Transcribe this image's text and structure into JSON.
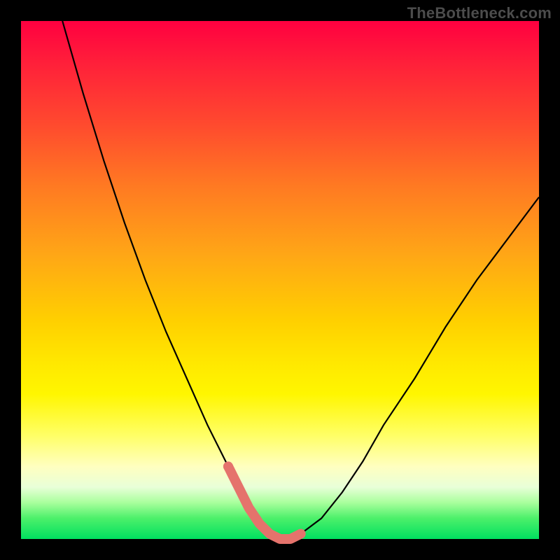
{
  "watermark": "TheBottleneck.com",
  "chart_data": {
    "type": "line",
    "title": "",
    "xlabel": "",
    "ylabel": "",
    "xlim": [
      0,
      100
    ],
    "ylim": [
      0,
      100
    ],
    "series": [
      {
        "name": "bottleneck-curve",
        "x": [
          8,
          12,
          16,
          20,
          24,
          28,
          32,
          36,
          38,
          40,
          42,
          44,
          46,
          48,
          50,
          52,
          54,
          58,
          62,
          66,
          70,
          76,
          82,
          88,
          94,
          100
        ],
        "y": [
          100,
          86,
          73,
          61,
          50,
          40,
          31,
          22,
          18,
          14,
          10,
          6,
          3,
          1,
          0,
          0,
          1,
          4,
          9,
          15,
          22,
          31,
          41,
          50,
          58,
          66
        ]
      },
      {
        "name": "highlight-basin",
        "x": [
          40,
          42,
          44,
          46,
          48,
          50,
          52,
          54
        ],
        "y": [
          14,
          10,
          6,
          3,
          1,
          0,
          0,
          1
        ]
      }
    ],
    "highlight_color": "#e5736c",
    "curve_color": "#000000"
  }
}
